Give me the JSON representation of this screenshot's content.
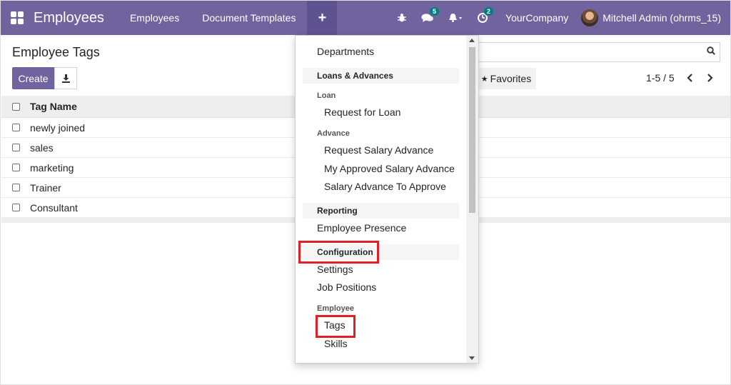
{
  "navbar": {
    "app_title": "Employees",
    "menu_employees": "Employees",
    "menu_doc_templates": "Document Templates",
    "plus_label": "+",
    "chat_count": "5",
    "activity_count": "2",
    "company": "YourCompany",
    "user": "Mitchell Admin (ohrms_15)"
  },
  "control": {
    "title": "Employee Tags",
    "create_label": "Create",
    "favorites_label": "Favorites",
    "pager": "1-5 / 5"
  },
  "list": {
    "column_header": "Tag Name",
    "rows": [
      "newly joined",
      "sales",
      "marketing",
      "Trainer",
      "Consultant"
    ]
  },
  "dropdown": {
    "departments": "Departments",
    "loans_header": "Loans & Advances",
    "loan_sub": "Loan",
    "request_loan": "Request for Loan",
    "advance_sub": "Advance",
    "request_salary_advance": "Request Salary Advance",
    "my_approved": "My Approved Salary Advance",
    "to_approve": "Salary Advance To Approve",
    "reporting_header": "Reporting",
    "employee_presence": "Employee Presence",
    "configuration_header": "Configuration",
    "settings": "Settings",
    "job_positions": "Job Positions",
    "employee_sub": "Employee",
    "tags": "Tags",
    "skills": "Skills"
  },
  "colors": {
    "brand": "#71639e",
    "badge": "#017e84",
    "highlight": "#e01f26"
  }
}
